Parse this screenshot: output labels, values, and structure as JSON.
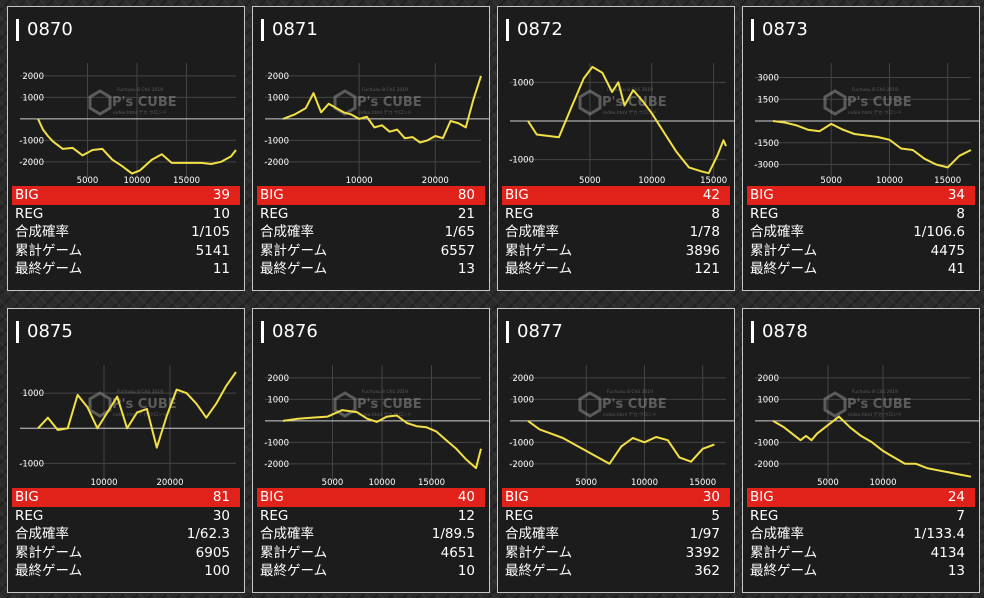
{
  "labels": {
    "big": "BIG",
    "reg": "REG",
    "rate": "合成確率",
    "total": "累計ゲーム",
    "last": "最終ゲーム"
  },
  "watermark": {
    "logo": "P's CUBE",
    "sub": "Fuchuku 8 Chō 2019",
    "sub2": "index.html デカ ウロンド"
  },
  "colors": {
    "line": "#f1e046",
    "big_bg": "#e0221b",
    "card_bg": "#1c1c1c",
    "border": "#c8c8c8"
  },
  "machines": [
    {
      "id": "0870",
      "big": "39",
      "reg": "10",
      "rate": "1/105",
      "total": "5141",
      "last": "11",
      "chart_data": {
        "type": "line",
        "xticks": [
          5000,
          10000,
          15000
        ],
        "yticks": [
          2000,
          1000,
          -1000,
          -2000
        ],
        "xlim": [
          0,
          20000
        ],
        "ylim": [
          -2800,
          2600
        ],
        "x": [
          0,
          500,
          1000,
          1500,
          2500,
          3500,
          4500,
          5500,
          6500,
          7500,
          8500,
          9500,
          10300,
          11500,
          12500,
          13500,
          14500,
          15500,
          16500,
          17500,
          18500,
          19500,
          20000
        ],
        "y": [
          0,
          -500,
          -800,
          -1050,
          -1400,
          -1350,
          -1700,
          -1450,
          -1400,
          -1900,
          -2200,
          -2550,
          -2400,
          -1900,
          -1650,
          -2050,
          -2050,
          -2050,
          -2050,
          -2100,
          -2000,
          -1750,
          -1450
        ]
      }
    },
    {
      "id": "0871",
      "big": "80",
      "reg": "21",
      "rate": "1/65",
      "total": "6557",
      "last": "13",
      "chart_data": {
        "type": "line",
        "xticks": [
          10000,
          20000
        ],
        "yticks": [
          2000,
          1000,
          -1000,
          -2000
        ],
        "xlim": [
          0,
          26000
        ],
        "ylim": [
          -2800,
          2600
        ],
        "x": [
          0,
          1500,
          3000,
          4000,
          5000,
          6000,
          7000,
          8000,
          9000,
          10000,
          11000,
          12000,
          13000,
          14000,
          15000,
          16000,
          17000,
          18000,
          19000,
          20000,
          21000,
          22000,
          23000,
          24000,
          25000,
          26000
        ],
        "y": [
          0,
          200,
          500,
          1200,
          300,
          700,
          500,
          300,
          200,
          0,
          100,
          -400,
          -300,
          -600,
          -500,
          -900,
          -850,
          -1100,
          -1000,
          -800,
          -900,
          -100,
          -200,
          -400,
          900,
          2000
        ]
      }
    },
    {
      "id": "0872",
      "big": "42",
      "reg": "8",
      "rate": "1/78",
      "total": "3896",
      "last": "121",
      "chart_data": {
        "type": "line",
        "xticks": [
          5000,
          10000,
          15000
        ],
        "yticks": [
          1000,
          -1000
        ],
        "xlim": [
          0,
          16000
        ],
        "ylim": [
          -1500,
          1500
        ],
        "x": [
          0,
          700,
          1500,
          2500,
          3500,
          4500,
          5200,
          6000,
          6800,
          7300,
          7800,
          8500,
          9300,
          10000,
          11000,
          12000,
          13000,
          14000,
          14600,
          15300,
          15800,
          16000
        ],
        "y": [
          0,
          -350,
          -380,
          -420,
          350,
          1100,
          1400,
          1250,
          750,
          1000,
          400,
          800,
          500,
          200,
          -300,
          -800,
          -1200,
          -1300,
          -1350,
          -900,
          -500,
          -650
        ]
      }
    },
    {
      "id": "0873",
      "big": "34",
      "reg": "8",
      "rate": "1/106.6",
      "total": "4475",
      "last": "41",
      "chart_data": {
        "type": "line",
        "xticks": [
          5000,
          10000,
          15000
        ],
        "yticks": [
          3000,
          1500,
          -1500,
          -3000
        ],
        "xlim": [
          0,
          17000
        ],
        "ylim": [
          -4000,
          4000
        ],
        "x": [
          0,
          1000,
          2000,
          3000,
          4000,
          5000,
          6000,
          7000,
          8000,
          9000,
          10000,
          11000,
          12000,
          13000,
          14000,
          15000,
          16000,
          17000
        ],
        "y": [
          0,
          -100,
          -300,
          -600,
          -700,
          -200,
          -600,
          -900,
          -1000,
          -1100,
          -1300,
          -1900,
          -2000,
          -2600,
          -3000,
          -3200,
          -2400,
          -2000
        ]
      }
    },
    {
      "id": "0875",
      "big": "81",
      "reg": "30",
      "rate": "1/62.3",
      "total": "6905",
      "last": "100",
      "chart_data": {
        "type": "line",
        "xticks": [
          10000,
          20000
        ],
        "yticks": [
          1000,
          -1000
        ],
        "xlim": [
          0,
          30000
        ],
        "ylim": [
          -1500,
          1800
        ],
        "x": [
          0,
          1500,
          3000,
          4500,
          6000,
          7500,
          9000,
          10500,
          12000,
          13500,
          15000,
          16500,
          18000,
          19500,
          21000,
          22500,
          24000,
          25500,
          27000,
          28500,
          30000
        ],
        "y": [
          0,
          300,
          -50,
          0,
          950,
          600,
          0,
          450,
          900,
          0,
          450,
          550,
          -550,
          350,
          1100,
          1000,
          700,
          300,
          700,
          1200,
          1600
        ]
      }
    },
    {
      "id": "0876",
      "big": "40",
      "reg": "12",
      "rate": "1/89.5",
      "total": "4651",
      "last": "10",
      "chart_data": {
        "type": "line",
        "xticks": [
          5000,
          10000,
          15000
        ],
        "yticks": [
          2000,
          1000,
          -1000,
          -2000
        ],
        "xlim": [
          0,
          20000
        ],
        "ylim": [
          -2800,
          2600
        ],
        "x": [
          0,
          1500,
          3000,
          4500,
          6000,
          7500,
          8500,
          9500,
          10500,
          11500,
          12500,
          13500,
          14500,
          15500,
          16500,
          17500,
          18500,
          19500,
          20000
        ],
        "y": [
          0,
          100,
          150,
          200,
          500,
          400,
          100,
          -50,
          200,
          250,
          -100,
          -250,
          -300,
          -500,
          -900,
          -1300,
          -1800,
          -2200,
          -1300
        ]
      }
    },
    {
      "id": "0877",
      "big": "30",
      "reg": "5",
      "rate": "1/97",
      "total": "3392",
      "last": "362",
      "chart_data": {
        "type": "line",
        "xticks": [
          5000,
          10000,
          15000
        ],
        "yticks": [
          2000,
          1000,
          -1000,
          -2000
        ],
        "xlim": [
          0,
          17000
        ],
        "ylim": [
          -2800,
          2600
        ],
        "x": [
          0,
          1000,
          2000,
          3000,
          4000,
          5000,
          6000,
          7000,
          8000,
          9000,
          10000,
          11000,
          12000,
          13000,
          14000,
          15000,
          16000
        ],
        "y": [
          0,
          -400,
          -600,
          -800,
          -1100,
          -1400,
          -1700,
          -2000,
          -1200,
          -800,
          -1000,
          -750,
          -900,
          -1700,
          -1900,
          -1300,
          -1100
        ]
      }
    },
    {
      "id": "0878",
      "big": "24",
      "reg": "7",
      "rate": "1/133.4",
      "total": "4134",
      "last": "13",
      "chart_data": {
        "type": "line",
        "xticks": [
          5000,
          10000
        ],
        "yticks": [
          2000,
          1000,
          -1000,
          -2000
        ],
        "xlim": [
          0,
          18000
        ],
        "ylim": [
          -2800,
          2600
        ],
        "x": [
          0,
          1000,
          2000,
          2500,
          3000,
          3500,
          4000,
          5000,
          6000,
          7000,
          8000,
          9000,
          10000,
          11000,
          12000,
          13000,
          14000,
          15000,
          16000,
          17000,
          18000
        ],
        "y": [
          0,
          -300,
          -700,
          -900,
          -700,
          -900,
          -600,
          -200,
          200,
          -300,
          -700,
          -1000,
          -1400,
          -1700,
          -2000,
          -2000,
          -2200,
          -2300,
          -2400,
          -2500,
          -2600
        ]
      }
    }
  ]
}
